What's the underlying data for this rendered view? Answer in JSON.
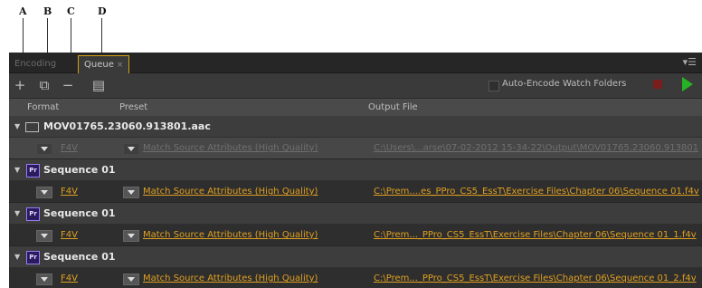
{
  "callouts": [
    "A",
    "B",
    "C",
    "D"
  ],
  "tabs": {
    "encoding": "Encoding",
    "queue": "Queue",
    "close": "×",
    "menu": "▾☰"
  },
  "toolbar": {
    "add": "+",
    "duplicate": "⧉",
    "remove": "−",
    "settings": "▤",
    "auto_encode_label": "Auto-Encode Watch Folders"
  },
  "columns": {
    "format": "Format",
    "preset": "Preset",
    "output": "Output File"
  },
  "items": [
    {
      "name": "MOV01765.23060.913801.aac",
      "format": "F4V",
      "preset": "Match Source Attributes (High Quality)",
      "output": "C:\\Users\\...arse\\07-02-2012 15-34-22\\Output\\MOV01765.23060.913801"
    },
    {
      "name": "Sequence 01",
      "icon": "Pr",
      "format": "F4V",
      "preset": "Match Source Attributes (High Quality)",
      "output": "C:\\Prem....es_PPro_CS5_EssT\\Exercise Files\\Chapter 06\\Sequence 01.f4v"
    },
    {
      "name": "Sequence 01",
      "icon": "Pr",
      "format": "F4V",
      "preset": "Match Source Attributes (High Quality)",
      "output": "C:\\Prem..._PPro_CS5_EssT\\Exercise Files\\Chapter 06\\Sequence 01_1.f4v"
    },
    {
      "name": "Sequence 01",
      "icon": "Pr",
      "format": "F4V",
      "preset": "Match Source Attributes (High Quality)",
      "output": "C:\\Prem..._PPro_CS5_EssT\\Exercise Files\\Chapter 06\\Sequence 01_2.f4v"
    }
  ]
}
